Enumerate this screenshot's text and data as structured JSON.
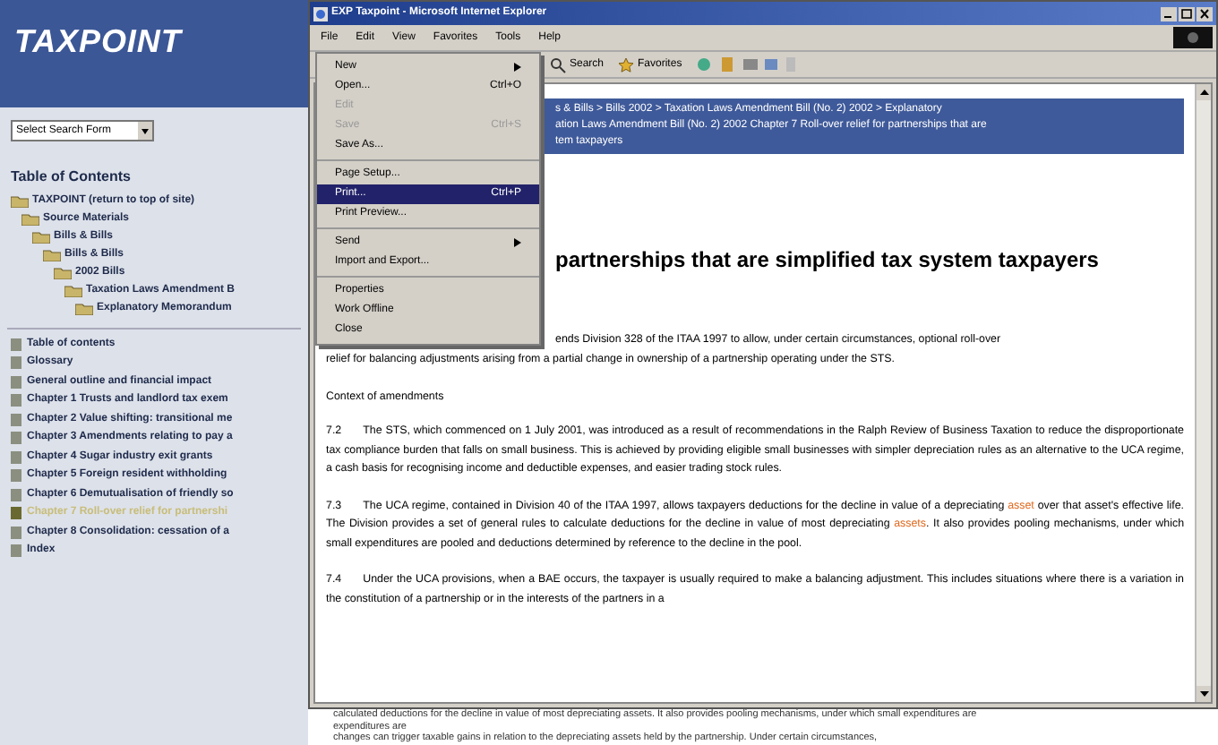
{
  "sidebar": {
    "logo": "TAXPOINT",
    "search_select": "Select Search Form",
    "toc_title": "Table of Contents",
    "tree": [
      {
        "label": "TAXPOINT (return to top of site)",
        "children": [
          {
            "label": "Source Materials",
            "children": [
              {
                "label": "Bills & Bills",
                "children": [
                  {
                    "label": "Bills & Bills",
                    "children": [
                      {
                        "label": "2002 Bills",
                        "children": [
                          {
                            "label": "Taxation Laws Amendment B",
                            "children": [
                              {
                                "label": "Explanatory Memorandum"
                              }
                            ]
                          }
                        ]
                      }
                    ]
                  }
                ]
              }
            ]
          }
        ]
      }
    ],
    "chapters": [
      {
        "label": "Table of contents",
        "selected": false
      },
      {
        "label": "Glossary",
        "selected": false
      },
      {
        "label": "General outline and financial impact",
        "selected": false
      },
      {
        "label": "Chapter 1 Trusts and landlord tax exem",
        "selected": false
      },
      {
        "label": "Chapter 2 Value shifting: transitional me",
        "selected": false
      },
      {
        "label": "Chapter 3 Amendments relating to pay a",
        "selected": false
      },
      {
        "label": "Chapter 4 Sugar industry exit grants",
        "selected": false
      },
      {
        "label": "Chapter 5 Foreign resident withholding",
        "selected": false
      },
      {
        "label": "Chapter 6 Demutualisation of friendly so",
        "selected": false
      },
      {
        "label": "Chapter 7 Roll-over relief for partnershi",
        "selected": true
      },
      {
        "label": "Chapter 8 Consolidation: cessation of a",
        "selected": false
      },
      {
        "label": "Index",
        "selected": false
      }
    ]
  },
  "window": {
    "title": "EXP Taxpoint - Microsoft Internet Explorer",
    "menu": [
      "File",
      "Edit",
      "View",
      "Favorites",
      "Tools",
      "Help"
    ],
    "toolbar": [
      {
        "label": "Search",
        "kind": "search"
      },
      {
        "label": "Favorites",
        "kind": "favorites"
      }
    ],
    "file_menu": [
      [
        {
          "label": "New",
          "submenu": true,
          "disabled": false,
          "selected": false
        },
        {
          "label": "Open...",
          "shortcut": "Ctrl+O",
          "submenu": false,
          "disabled": false,
          "selected": false
        },
        {
          "label": "Edit",
          "submenu": false,
          "disabled": true,
          "selected": false
        },
        {
          "label": "Save",
          "shortcut": "Ctrl+S",
          "submenu": false,
          "disabled": true,
          "selected": false
        },
        {
          "label": "Save As...",
          "submenu": false,
          "disabled": false,
          "selected": false
        }
      ],
      [
        {
          "label": "Page Setup...",
          "submenu": false,
          "disabled": false,
          "selected": false
        },
        {
          "label": "Print...",
          "shortcut": "Ctrl+P",
          "submenu": false,
          "disabled": false,
          "selected": true
        },
        {
          "label": "Print Preview...",
          "submenu": false,
          "disabled": false,
          "selected": false
        }
      ],
      [
        {
          "label": "Send",
          "submenu": true,
          "disabled": false,
          "selected": false
        },
        {
          "label": "Import and Export...",
          "submenu": false,
          "disabled": false,
          "selected": false
        }
      ],
      [
        {
          "label": "Properties",
          "submenu": false,
          "disabled": false,
          "selected": false
        },
        {
          "label": "Work Offline",
          "submenu": false,
          "disabled": false,
          "selected": false
        },
        {
          "label": "Close",
          "submenu": false,
          "disabled": false,
          "selected": false
        }
      ]
    ]
  },
  "content": {
    "breadcrumb": [
      "s & Bills > Bills 2002 > Taxation Laws Amendment Bill (No. 2) 2002 > Explanatory",
      "ation Laws Amendment Bill (No. 2) 2002 Chapter 7 Roll-over relief for partnerships that are",
      "tem taxpayers"
    ],
    "heading": "partnerships that are simplified tax system taxpayers",
    "intro": [
      "ends Division 328 of the ITAA 1997 to allow, under certain circumstances, optional roll-over",
      "relief for balancing adjustments arising from a partial change in ownership of a partnership operating under the STS."
    ],
    "context": "Context of amendments",
    "paragraphs": [
      {
        "number": "7.2",
        "segments": [
          {
            "text": "The STS, which commenced on 1 July 2001, was introduced as a result of recommendations in the Ralph Review of Business Taxation to reduce the disproportionate tax compliance burden that falls on small business. This is achieved by providing eligible small businesses with simpler depreciation rules as an alternative to the UCA regime, a cash basis for recognising income and deductible expenses, and easier trading stock rules.",
            "highlighted": false
          }
        ]
      },
      {
        "number": "7.3",
        "segments": [
          {
            "text": "The UCA regime, contained in Division 40 of the ITAA 1997, allows taxpayers deductions for the decline in value of a depreciating ",
            "highlighted": false
          },
          {
            "text": "asset",
            "highlighted": true
          },
          {
            "text": " over that asset's effective life. The Division provides a set of general rules to calculate deductions for the decline in value of most depreciating ",
            "highlighted": false
          },
          {
            "text": "assets",
            "highlighted": true
          },
          {
            "text": ". It also provides pooling mechanisms, under which small expenditures are pooled and deductions determined by reference to the decline in the pool.",
            "highlighted": false
          }
        ]
      },
      {
        "number": "7.4",
        "segments": [
          {
            "text": "Under the UCA provisions, when a BAE occurs, the taxpayer is usually required to make a balancing adjustment. This includes situations where there is a variation in the constitution of a partnership or in the interests of the partners in a",
            "highlighted": false
          }
        ]
      }
    ],
    "below": [
      "calculated deductions for the decline in value of most depreciating assets. It also provides pooling mechanisms, under which small expenditures are",
      "expenditures are",
      "changes can trigger taxable gains in relation to the depreciating assets held by the partnership. Under certain circumstances,"
    ]
  }
}
